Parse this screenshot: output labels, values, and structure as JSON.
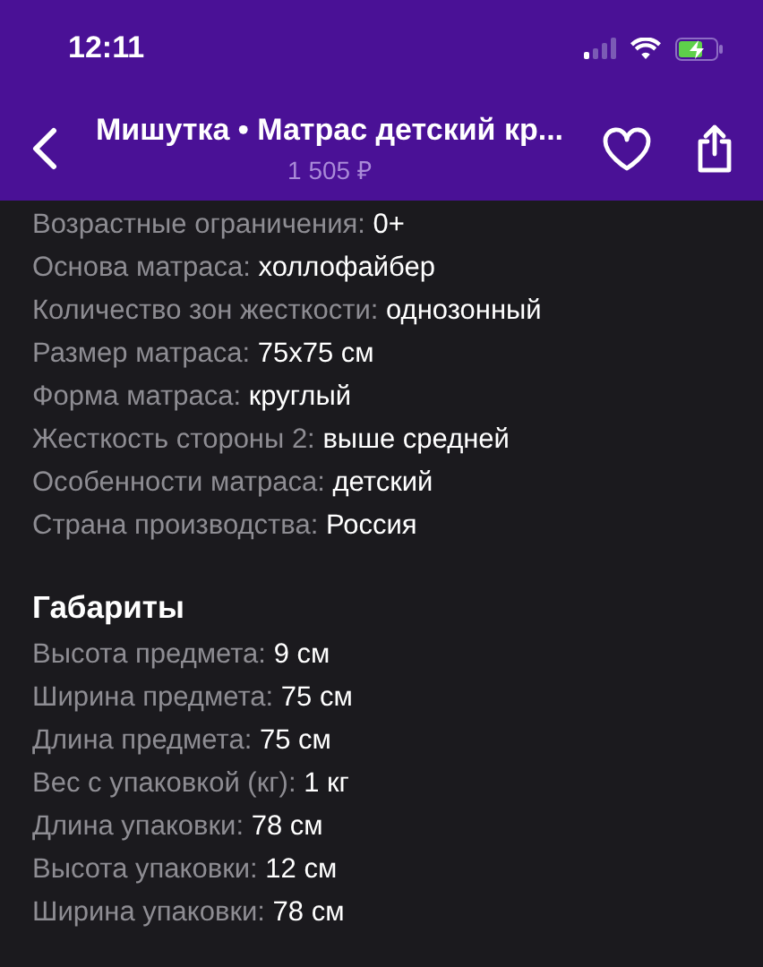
{
  "status_bar": {
    "time": "12:11"
  },
  "header": {
    "title": "Мишутка • Матрас детский кр...",
    "price": "1 505 ₽"
  },
  "sections": [
    {
      "rows": [
        {
          "label": "Возрастные ограничения:",
          "value": "0+"
        },
        {
          "label": "Основа матраса:",
          "value": "холлофайбер"
        },
        {
          "label": "Количество зон жесткости:",
          "value": "однозонный"
        },
        {
          "label": "Размер матраса:",
          "value": "75x75 см"
        },
        {
          "label": "Форма матраса:",
          "value": "круглый"
        },
        {
          "label": "Жесткость стороны 2:",
          "value": "выше средней"
        },
        {
          "label": "Особенности матраса:",
          "value": "детский"
        },
        {
          "label": "Страна производства:",
          "value": "Россия"
        }
      ]
    },
    {
      "title": "Габариты",
      "rows": [
        {
          "label": "Высота предмета:",
          "value": "9 см"
        },
        {
          "label": "Ширина предмета:",
          "value": "75 см"
        },
        {
          "label": "Длина предмета:",
          "value": "75 см"
        },
        {
          "label": "Вес с упаковкой (кг):",
          "value": "1 кг"
        },
        {
          "label": "Длина упаковки:",
          "value": "78 см"
        },
        {
          "label": "Высота упаковки:",
          "value": "12 см"
        },
        {
          "label": "Ширина упаковки:",
          "value": "78 см"
        }
      ]
    }
  ]
}
